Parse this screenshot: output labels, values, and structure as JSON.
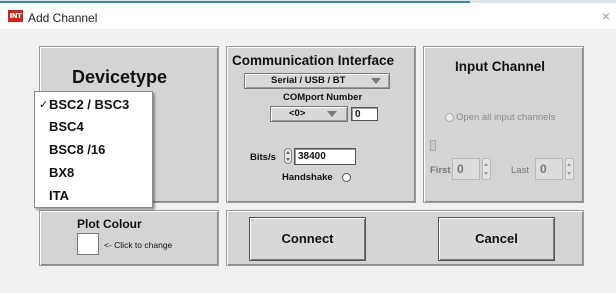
{
  "window": {
    "title": "Add Channel",
    "icon_text": "INT",
    "close_glyph": "×",
    "accent_color": "#3c8d9a"
  },
  "device_panel": {
    "title": "Devicetype",
    "check_glyph": "✓",
    "items": [
      {
        "label": "BSC2 / BSC3",
        "checked": true
      },
      {
        "label": "BSC4",
        "checked": false
      },
      {
        "label": "BSC8 /16",
        "checked": false
      },
      {
        "label": "BX8",
        "checked": false
      },
      {
        "label": "ITA",
        "checked": false
      }
    ]
  },
  "comm_panel": {
    "title": "Communication Interface",
    "interface_value": "Serial / USB / BT",
    "comport_label": "COMport Number",
    "comport_ring_value": "<0>",
    "comport_number": "0",
    "bits_label": "Bits/s",
    "bits_value": "38400",
    "handshake_label": "Handshake",
    "handshake_on": false
  },
  "input_panel": {
    "title": "Input Channel",
    "open_all_label": "Open all input channels",
    "first_label": "First",
    "first_value": "0",
    "last_label": "Last",
    "last_value": "0"
  },
  "plot_panel": {
    "title": "Plot Colour",
    "click_hint": "<- Click to change",
    "swatch_color": "#ffffff"
  },
  "buttons": {
    "connect": "Connect",
    "cancel": "Cancel"
  }
}
